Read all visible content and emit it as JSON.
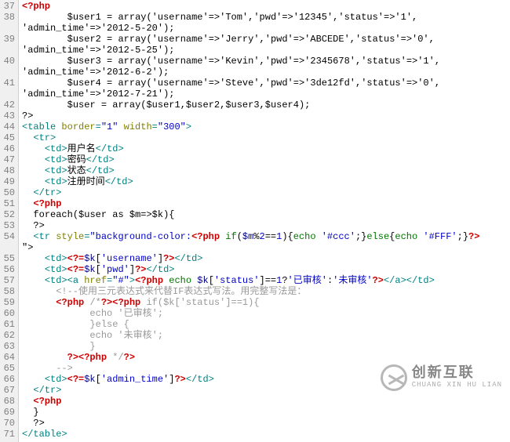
{
  "line_start": 37,
  "line_end": 71,
  "watermark": {
    "cn": "创新互联",
    "en": "CHUANG XIN HU LIAN"
  },
  "users": [
    {
      "username": "Tom",
      "pwd": "12345",
      "status": "1",
      "admin_time": "2012-5-20"
    },
    {
      "username": "Jerry",
      "pwd": "ABCEDE",
      "status": "0",
      "admin_time": "2012-5-25"
    },
    {
      "username": "Kevin",
      "pwd": "2345678",
      "status": "1",
      "admin_time": "2012-6-2"
    },
    {
      "username": "Steve",
      "pwd": "3de12fd",
      "status": "0",
      "admin_time": "2012-7-21"
    }
  ],
  "table": {
    "border": "1",
    "width": "300"
  },
  "headers": {
    "username": "用户名",
    "pwd": "密码",
    "status": "状态",
    "admin_time": "注册时间"
  },
  "loop": {
    "expr": "foreach($user as $m=>$k){",
    "end": "}"
  },
  "row_style": {
    "if": "if($m%2==1){echo '#ccc';}else{echo '#FFF';}"
  },
  "status_labels": {
    "reviewed": "已审核",
    "unreviewed": "未审核"
  },
  "comment": {
    "text": "<!--使用三元表达式来代替IF表达式写法。用完整写法是："
  },
  "snippet_comment": "/*?><?php if($k['status']==1){",
  "code_lines": [
    "<?php",
    "        $user1 = array('username'=>'Tom','pwd'=>'12345','status'=>'1','admin_time'=>'2012-5-20');",
    "        $user2 = array('username'=>'Jerry','pwd'=>'ABCEDE','status'=>'0','admin_time'=>'2012-5-25');",
    "        $user3 = array('username'=>'Kevin','pwd'=>'2345678','status'=>'1','admin_time'=>'2012-6-2');",
    "        $user4 = array('username'=>'Steve','pwd'=>'3de12fd','status'=>'0','admin_time'=>'2012-7-21');",
    "        $user = array($user1,$user2,$user3,$user4);",
    "?>",
    "<table border=\"1\" width=\"300\">",
    "  <tr>",
    "    <td>用户名</td>",
    "    <td>密码</td>",
    "    <td>状态</td>",
    "    <td>注册时间</td>",
    "  </tr>",
    "  <?php",
    "  foreach($user as $m=>$k){",
    "  ?>",
    "  <tr style=\"background-color:<?php if($m%2==1){echo '#ccc';}else{echo '#FFF';}?>\">",
    "    <td><?=$k['username']?></td>",
    "    <td><?=$k['pwd']?></td>",
    "    <td><a href=\"#\"><?php echo $k['status']==1?'已审核':'未审核'?></a></td>",
    "      <!--使用三元表达式来代替IF表达式写法。用完整写法是：",
    "      <?php /*?><?php if($k['status']==1){",
    "            echo '已审核';",
    "            }else {",
    "            echo '未审核';",
    "            }",
    "        ?><?php */?>",
    "      -->",
    "    <td><?=$k['admin_time']?></td>",
    "  </tr>",
    "  <?php",
    "  }",
    "  ?>",
    "</table>"
  ]
}
